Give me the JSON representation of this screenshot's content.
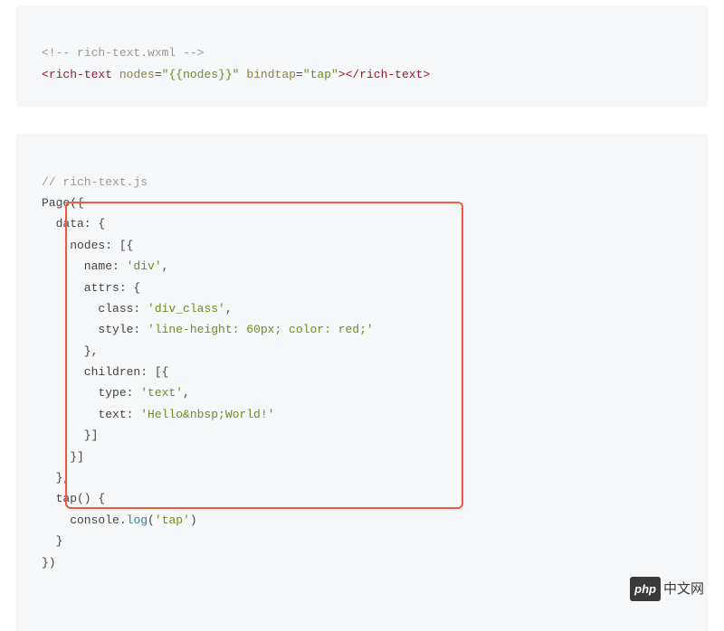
{
  "block1": {
    "comment_open": "<!--",
    "comment_text": " rich-text.wxml ",
    "comment_close": "-->",
    "tag_open": "<",
    "tag_name": "rich-text",
    "attr1_name": "nodes",
    "attr1_eq": "=",
    "attr1_val": "\"{{nodes}}\"",
    "attr2_name": "bindtap",
    "attr2_eq": "=",
    "attr2_val": "\"tap\"",
    "tag_close1": ">",
    "tag_close2": "</",
    "tag_close3": ">"
  },
  "block2": {
    "l1_comment": "// rich-text.js",
    "l2": "Page({",
    "l3": "  data: {",
    "l4": "    nodes: [{",
    "l5_key": "      name: ",
    "l5_val": "'div'",
    "l5_end": ",",
    "l6": "      attrs: {",
    "l7_key": "        class: ",
    "l7_val": "'div_class'",
    "l7_end": ",",
    "l8_key": "        style: ",
    "l8_val": "'line-height: 60px; color: red;'",
    "l9": "      },",
    "l10": "      children: [{",
    "l11_key": "        type: ",
    "l11_val": "'text'",
    "l11_end": ",",
    "l12_key": "        text: ",
    "l12_val": "'Hello&nbsp;World!'",
    "l13": "      }]",
    "l14": "    }]",
    "l15": "  },",
    "l16": "  tap() {",
    "l17_obj": "    console",
    "l17_dot": ".",
    "l17_fn": "log",
    "l17_open": "(",
    "l17_arg": "'tap'",
    "l17_close": ")",
    "l18": "  }",
    "l19": "})"
  },
  "watermark": {
    "logo": "php",
    "text": "中文网"
  }
}
